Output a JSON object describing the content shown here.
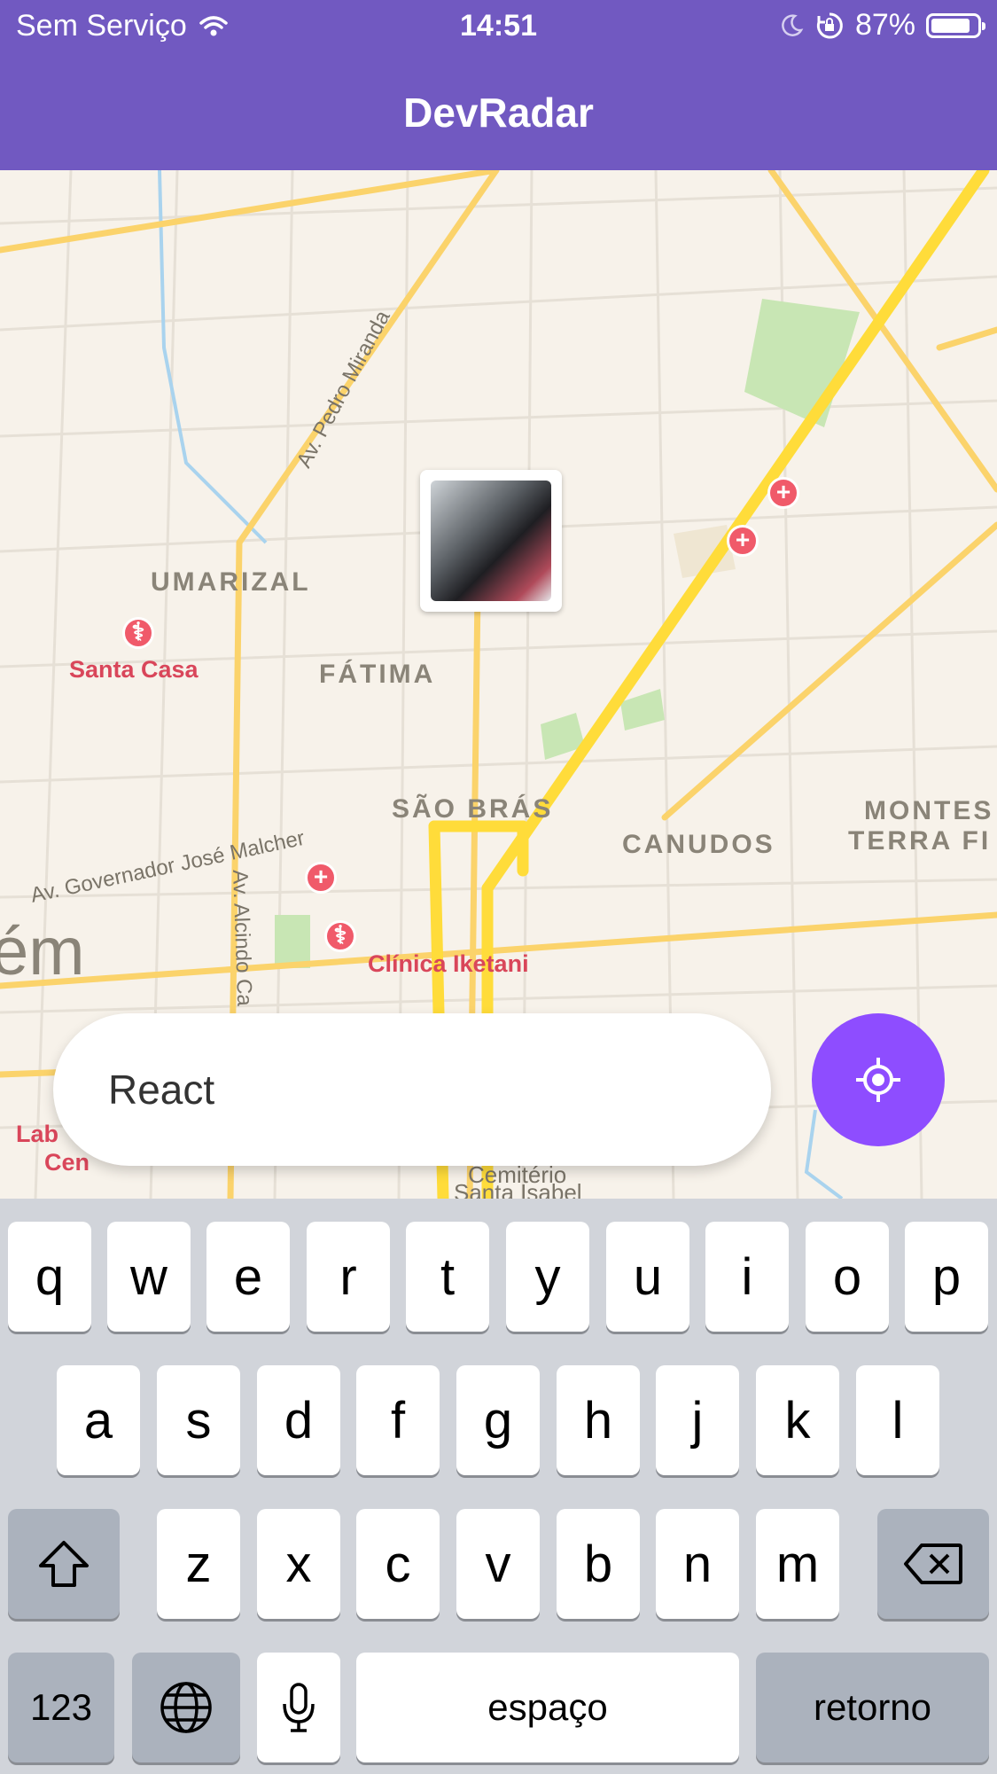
{
  "status_bar": {
    "carrier": "Sem Serviço",
    "time": "14:51",
    "battery": "87%",
    "battery_level": 0.87
  },
  "header": {
    "title": "DevRadar"
  },
  "map": {
    "neighborhoods": [
      "UMARIZAL",
      "FÁTIMA",
      "SÃO BRÁS",
      "CANUDOS",
      "MONTES",
      "TERRA FI"
    ],
    "streets": [
      "Av. Pedro Miranda",
      "Av. Governador José Malcher",
      "Av. Alcindo Ca"
    ],
    "pois": [
      "Santa Casa",
      "Clínica Iketani",
      "Lab",
      "Cen",
      "Cemitério",
      "Santa Isabel"
    ],
    "city_fragment": "ém"
  },
  "search": {
    "value": "React",
    "placeholder": ""
  },
  "keyboard": {
    "row1": [
      "q",
      "w",
      "e",
      "r",
      "t",
      "y",
      "u",
      "i",
      "o",
      "p"
    ],
    "row2": [
      "a",
      "s",
      "d",
      "f",
      "g",
      "h",
      "j",
      "k",
      "l"
    ],
    "row3": [
      "z",
      "x",
      "c",
      "v",
      "b",
      "n",
      "m"
    ],
    "numbers": "123",
    "space": "espaço",
    "return": "retorno"
  },
  "colors": {
    "primary": "#7159c1",
    "location_button": "#8e4dff",
    "poi": "#f05a6a"
  }
}
